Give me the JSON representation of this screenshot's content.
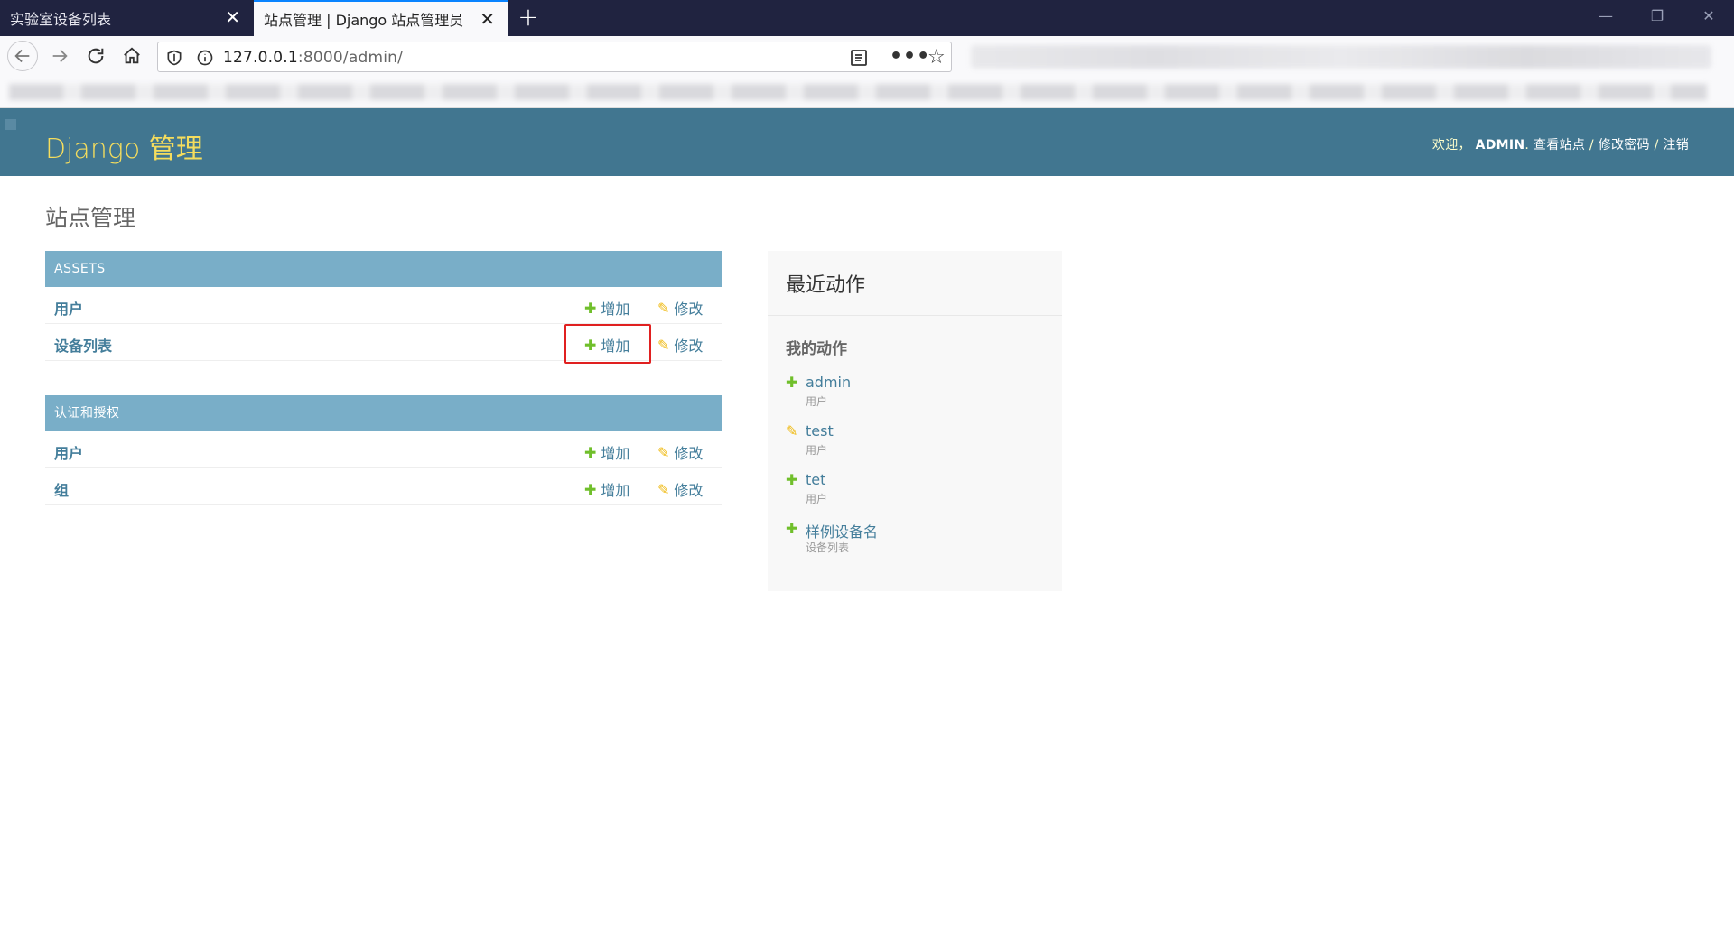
{
  "browser": {
    "tabs": [
      {
        "title": "实验室设备列表",
        "active": false
      },
      {
        "title": "站点管理 | Django 站点管理员",
        "active": true
      }
    ],
    "close_glyph": "✕",
    "new_tab_glyph": "+",
    "url_host": "127.0.0.1",
    "url_rest": ":8000/admin/",
    "more_glyph": "•••",
    "star_glyph": "☆",
    "window_buttons": [
      "—",
      "❐",
      "✕"
    ]
  },
  "header": {
    "branding": "Django 管理",
    "welcome": "欢迎，",
    "username": "ADMIN",
    "view_site": "查看站点",
    "change_password": "修改密码",
    "logout": "注销",
    "sep": " / "
  },
  "page_title": "站点管理",
  "modules": [
    {
      "caption": "ASSETS",
      "rows": [
        {
          "name": "用户",
          "add": "增加",
          "change": "修改"
        },
        {
          "name": "设备列表",
          "add": "增加",
          "change": "修改"
        }
      ]
    },
    {
      "caption": "认证和授权",
      "rows": [
        {
          "name": "用户",
          "add": "增加",
          "change": "修改"
        },
        {
          "name": "组",
          "add": "增加",
          "change": "修改"
        }
      ]
    }
  ],
  "icons": {
    "add": "✚",
    "change": "✎"
  },
  "recent_actions": {
    "title": "最近动作",
    "subtitle": "我的动作",
    "items": [
      {
        "action": "add",
        "name": "admin",
        "type": "用户"
      },
      {
        "action": "change",
        "name": "test",
        "type": "用户"
      },
      {
        "action": "add",
        "name": "tet",
        "type": "用户"
      },
      {
        "action": "add",
        "name": "样例设备名",
        "type": "设备列表"
      }
    ]
  },
  "colors": {
    "header_bg": "#417690",
    "branding": "#f5dd5d",
    "caption_bg": "#79aec8",
    "link": "#447e9b",
    "add_icon": "#70bf2b",
    "change_icon": "#efb80b",
    "highlight": "#e02020"
  }
}
